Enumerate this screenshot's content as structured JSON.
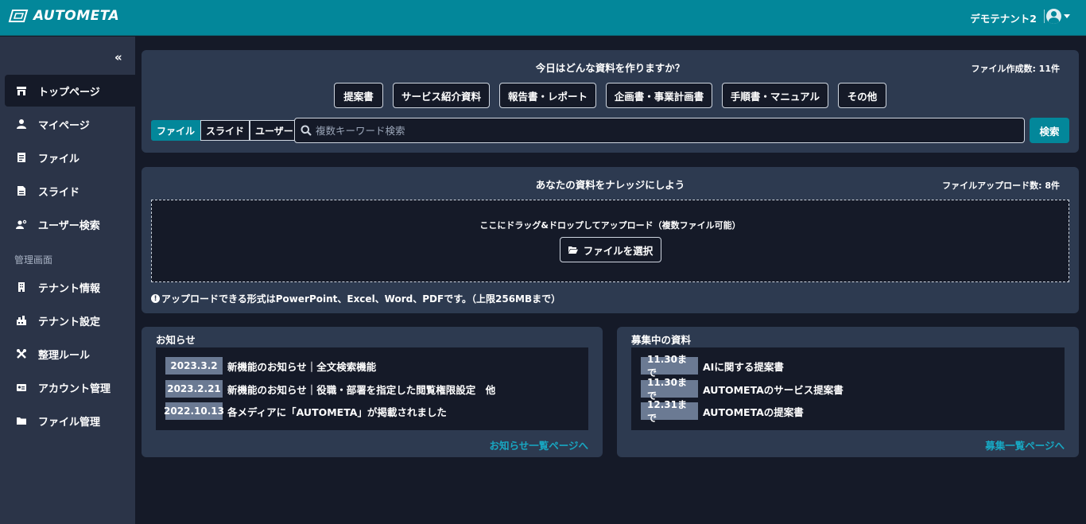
{
  "header": {
    "brand": "AUTOMETA",
    "tenant_name": "デモテナント2"
  },
  "sidebar": {
    "collapse_label": "«",
    "items": [
      {
        "label": "トップページ",
        "icon": "store-icon"
      },
      {
        "label": "マイページ",
        "icon": "user-icon"
      },
      {
        "label": "ファイル",
        "icon": "file-icon"
      },
      {
        "label": "スライド",
        "icon": "slide-icon"
      },
      {
        "label": "ユーザー検索",
        "icon": "user-search-icon"
      }
    ],
    "admin_section": "管理画面",
    "admin_items": [
      {
        "label": "テナント情報",
        "icon": "building-icon"
      },
      {
        "label": "テナント設定",
        "icon": "settings-icon"
      },
      {
        "label": "整理ルール",
        "icon": "tools-icon"
      },
      {
        "label": "アカウント管理",
        "icon": "id-card-icon"
      },
      {
        "label": "ファイル管理",
        "icon": "folder-icon"
      }
    ]
  },
  "create": {
    "title": "今日はどんな資料を作りますか？",
    "count": "ファイル作成数: 11件",
    "categories": [
      "提案書",
      "サービス紹介資料",
      "報告書・レポート",
      "企画書・事業計画書",
      "手順書・マニュアル",
      "その他"
    ],
    "tabs": [
      "ファイル",
      "スライド",
      "ユーザー"
    ],
    "search_placeholder": "複数キーワード検索",
    "search_button": "検索"
  },
  "upload": {
    "title": "あなたの資料をナレッジにしよう",
    "count": "ファイルアップロード数: 8件",
    "drop_text": "ここにドラッグ&ドロップしてアップロード（複数ファイル可能）",
    "select_button": "ファイルを選択",
    "note": "アップロードできる形式はPowerPoint、Excel、Word、PDFです。（上限256MBまで）"
  },
  "news": {
    "title": "お知らせ",
    "items": [
      {
        "date": "2023.3.2",
        "text": "新機能のお知らせ｜全文検索機能"
      },
      {
        "date": "2023.2.21",
        "text": "新機能のお知らせ｜役職・部署を指定した閲覧権限設定　他"
      },
      {
        "date": "2022.10.13",
        "text": "各メディアに「AUTOMETA」が掲載されました"
      }
    ],
    "more_link": "お知らせ一覧ページへ"
  },
  "recruiting": {
    "title": "募集中の資料",
    "items": [
      {
        "date": "11.30まで",
        "text": "AIに関する提案書"
      },
      {
        "date": "11.30まで",
        "text": "AUTOMETAのサービス提案書"
      },
      {
        "date": "12.31まで",
        "text": "AUTOMETAの提案書"
      }
    ],
    "more_link": "募集一覧ページへ"
  }
}
